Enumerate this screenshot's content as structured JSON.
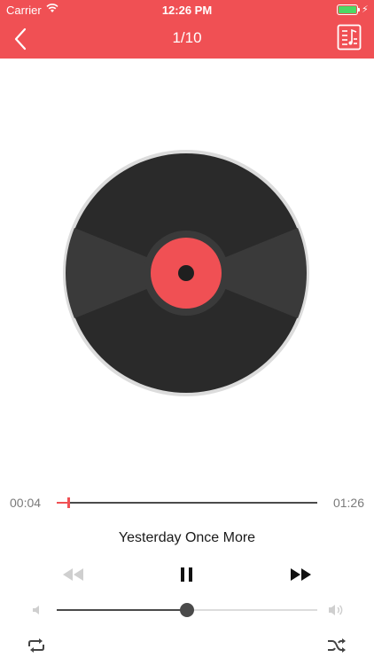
{
  "colors": {
    "accent": "#f05054",
    "disc": "#2a2a2a",
    "disc_rim": "#dcdcdc"
  },
  "status_bar": {
    "carrier": "Carrier",
    "time": "12:26 PM"
  },
  "nav": {
    "title": "1/10",
    "back_icon": "chevron-left-icon",
    "playlist_icon": "playlist-icon"
  },
  "player": {
    "elapsed": "00:04",
    "duration": "01:26",
    "progress_fraction": 0.045,
    "song_title": "Yesterday Once More",
    "volume_fraction": 0.5
  }
}
